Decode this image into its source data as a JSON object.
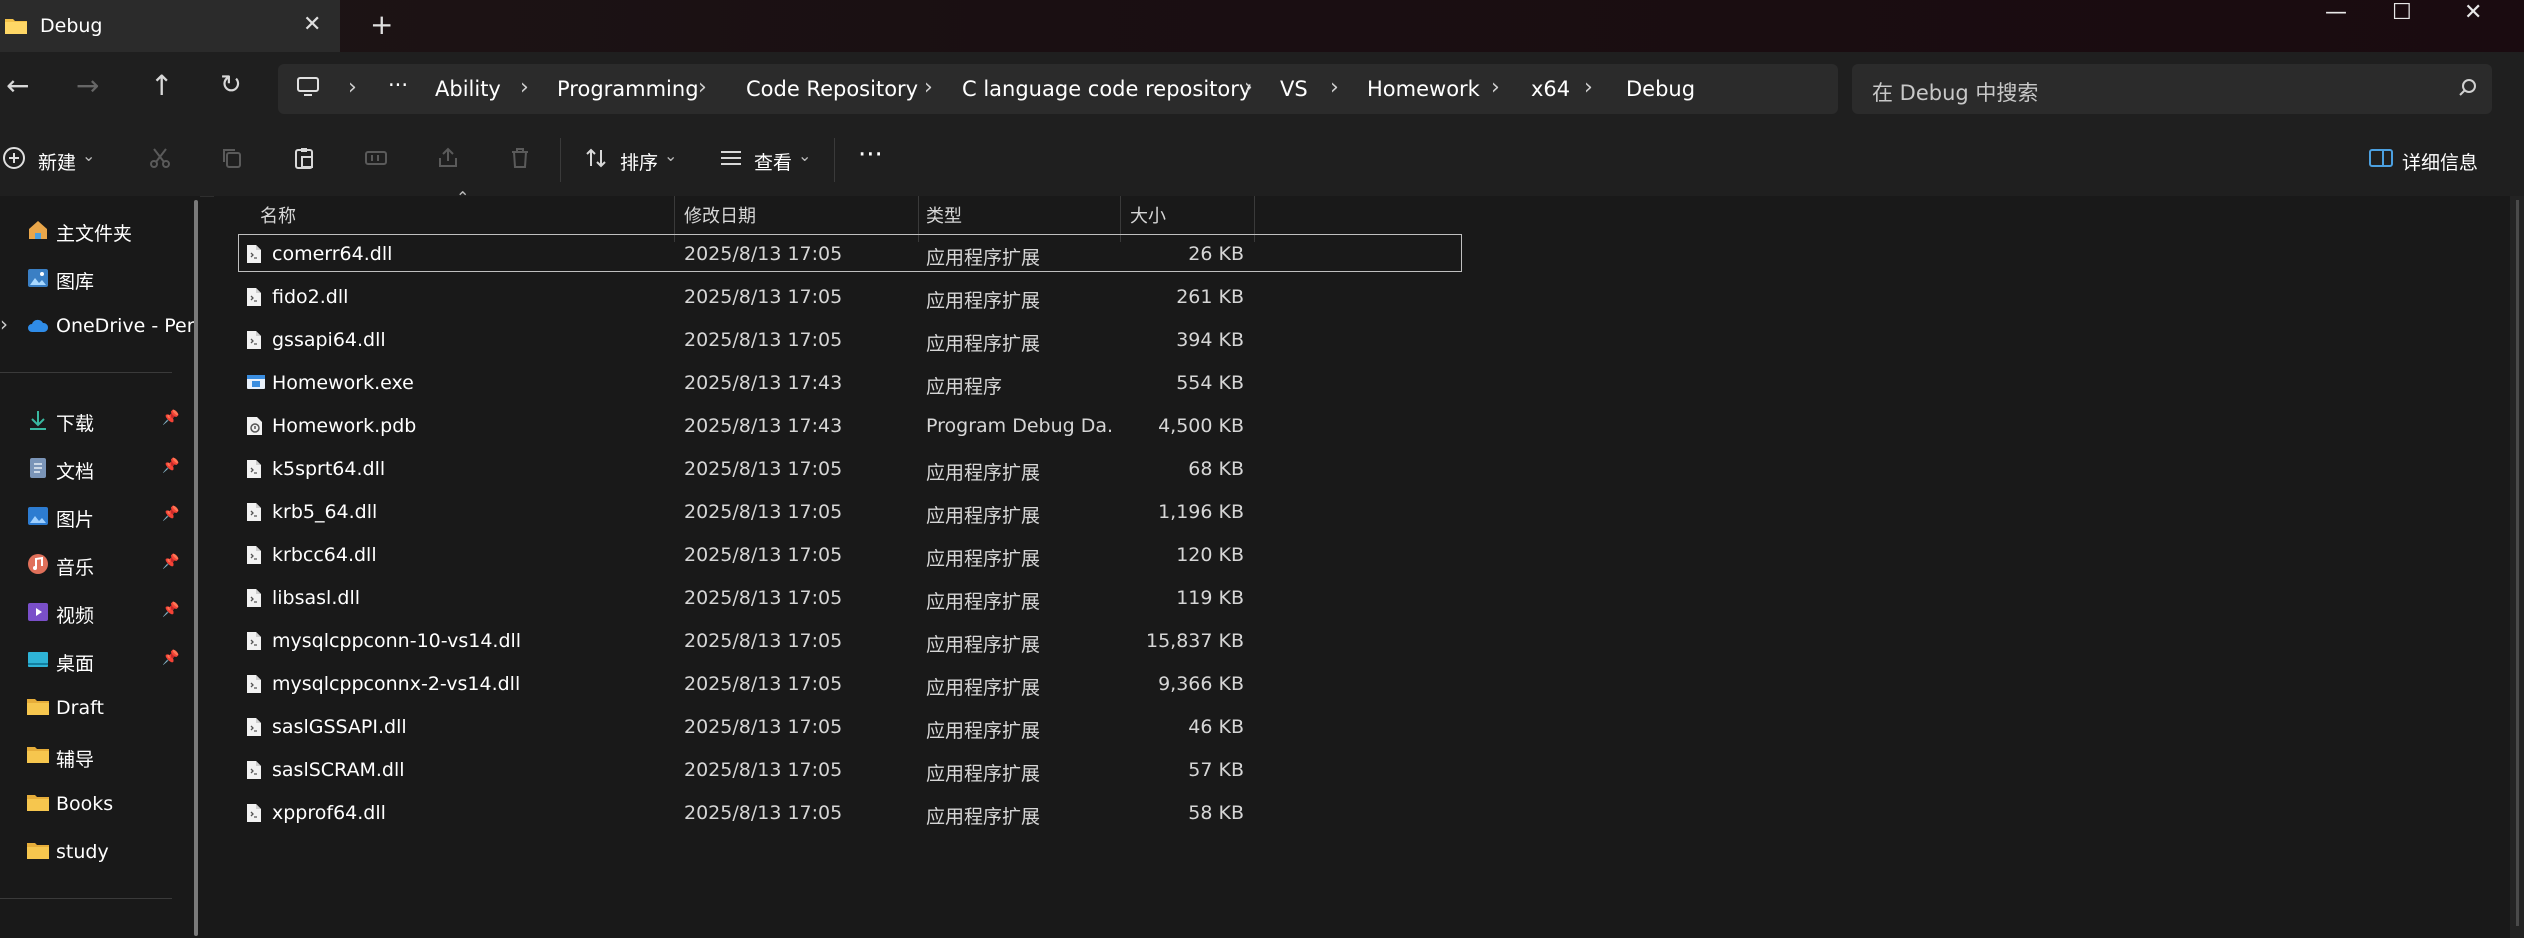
{
  "window": {
    "tab_title": "Debug",
    "tab_close_glyph": "✕",
    "new_tab_glyph": "+",
    "minimize_glyph": "—",
    "maximize_glyph": "☐",
    "close_glyph": "✕"
  },
  "nav": {
    "back_glyph": "←",
    "forward_glyph": "→",
    "up_glyph": "↑",
    "refresh_glyph": "↻"
  },
  "breadcrumb": {
    "more_glyph": "···",
    "separator_glyph": "›",
    "items": [
      "Ability",
      "Programming",
      "Code Repository",
      "C language code repository",
      "VS",
      "Homework",
      "x64",
      "Debug"
    ]
  },
  "search": {
    "placeholder": "在 Debug 中搜索"
  },
  "toolbar": {
    "new_label": "新建",
    "sort_label": "排序",
    "view_label": "查看",
    "more_glyph": "···",
    "details_label": "详细信息"
  },
  "sidebar": {
    "items": [
      {
        "label": "主文件夹",
        "icon": "home-icon",
        "pinned": false
      },
      {
        "label": "图库",
        "icon": "gallery-icon",
        "pinned": false
      },
      {
        "label": "OneDrive - Per",
        "icon": "onedrive-cloud-icon",
        "pinned": false
      },
      {
        "label": "下载",
        "icon": "download-icon",
        "pinned": true
      },
      {
        "label": "文档",
        "icon": "document-icon",
        "pinned": true
      },
      {
        "label": "图片",
        "icon": "pictures-icon",
        "pinned": true
      },
      {
        "label": "音乐",
        "icon": "music-icon",
        "pinned": true
      },
      {
        "label": "视频",
        "icon": "video-icon",
        "pinned": true
      },
      {
        "label": "桌面",
        "icon": "desktop-icon",
        "pinned": true
      },
      {
        "label": "Draft",
        "icon": "folder-icon",
        "pinned": false
      },
      {
        "label": "辅导",
        "icon": "folder-icon",
        "pinned": false
      },
      {
        "label": "Books",
        "icon": "folder-icon",
        "pinned": false
      },
      {
        "label": "study",
        "icon": "folder-icon",
        "pinned": false
      }
    ],
    "pin_glyph": "📌",
    "expand_glyph": "›"
  },
  "columns": {
    "name": "名称",
    "date": "修改日期",
    "type": "类型",
    "size": "大小",
    "sort_glyph": "⌃"
  },
  "files": [
    {
      "name": "comerr64.dll",
      "date": "2025/8/13 17:05",
      "type": "应用程序扩展",
      "size": "26 KB",
      "icon": "dll-file-icon",
      "selected": true
    },
    {
      "name": "fido2.dll",
      "date": "2025/8/13 17:05",
      "type": "应用程序扩展",
      "size": "261 KB",
      "icon": "dll-file-icon"
    },
    {
      "name": "gssapi64.dll",
      "date": "2025/8/13 17:05",
      "type": "应用程序扩展",
      "size": "394 KB",
      "icon": "dll-file-icon"
    },
    {
      "name": "Homework.exe",
      "date": "2025/8/13 17:43",
      "type": "应用程序",
      "size": "554 KB",
      "icon": "exe-file-icon"
    },
    {
      "name": "Homework.pdb",
      "date": "2025/8/13 17:43",
      "type": "Program Debug Da...",
      "size": "4,500 KB",
      "icon": "pdb-file-icon"
    },
    {
      "name": "k5sprt64.dll",
      "date": "2025/8/13 17:05",
      "type": "应用程序扩展",
      "size": "68 KB",
      "icon": "dll-file-icon"
    },
    {
      "name": "krb5_64.dll",
      "date": "2025/8/13 17:05",
      "type": "应用程序扩展",
      "size": "1,196 KB",
      "icon": "dll-file-icon"
    },
    {
      "name": "krbcc64.dll",
      "date": "2025/8/13 17:05",
      "type": "应用程序扩展",
      "size": "120 KB",
      "icon": "dll-file-icon"
    },
    {
      "name": "libsasl.dll",
      "date": "2025/8/13 17:05",
      "type": "应用程序扩展",
      "size": "119 KB",
      "icon": "dll-file-icon"
    },
    {
      "name": "mysqlcppconn-10-vs14.dll",
      "date": "2025/8/13 17:05",
      "type": "应用程序扩展",
      "size": "15,837 KB",
      "icon": "dll-file-icon"
    },
    {
      "name": "mysqlcppconnx-2-vs14.dll",
      "date": "2025/8/13 17:05",
      "type": "应用程序扩展",
      "size": "9,366 KB",
      "icon": "dll-file-icon"
    },
    {
      "name": "saslGSSAPI.dll",
      "date": "2025/8/13 17:05",
      "type": "应用程序扩展",
      "size": "46 KB",
      "icon": "dll-file-icon"
    },
    {
      "name": "saslSCRAM.dll",
      "date": "2025/8/13 17:05",
      "type": "应用程序扩展",
      "size": "57 KB",
      "icon": "dll-file-icon"
    },
    {
      "name": "xpprof64.dll",
      "date": "2025/8/13 17:05",
      "type": "应用程序扩展",
      "size": "58 KB",
      "icon": "dll-file-icon"
    }
  ],
  "colors": {
    "background": "#191919",
    "toolbar": "#1f1f1f",
    "folder": "#f3c149",
    "accent_blue": "#4ca0e0"
  }
}
